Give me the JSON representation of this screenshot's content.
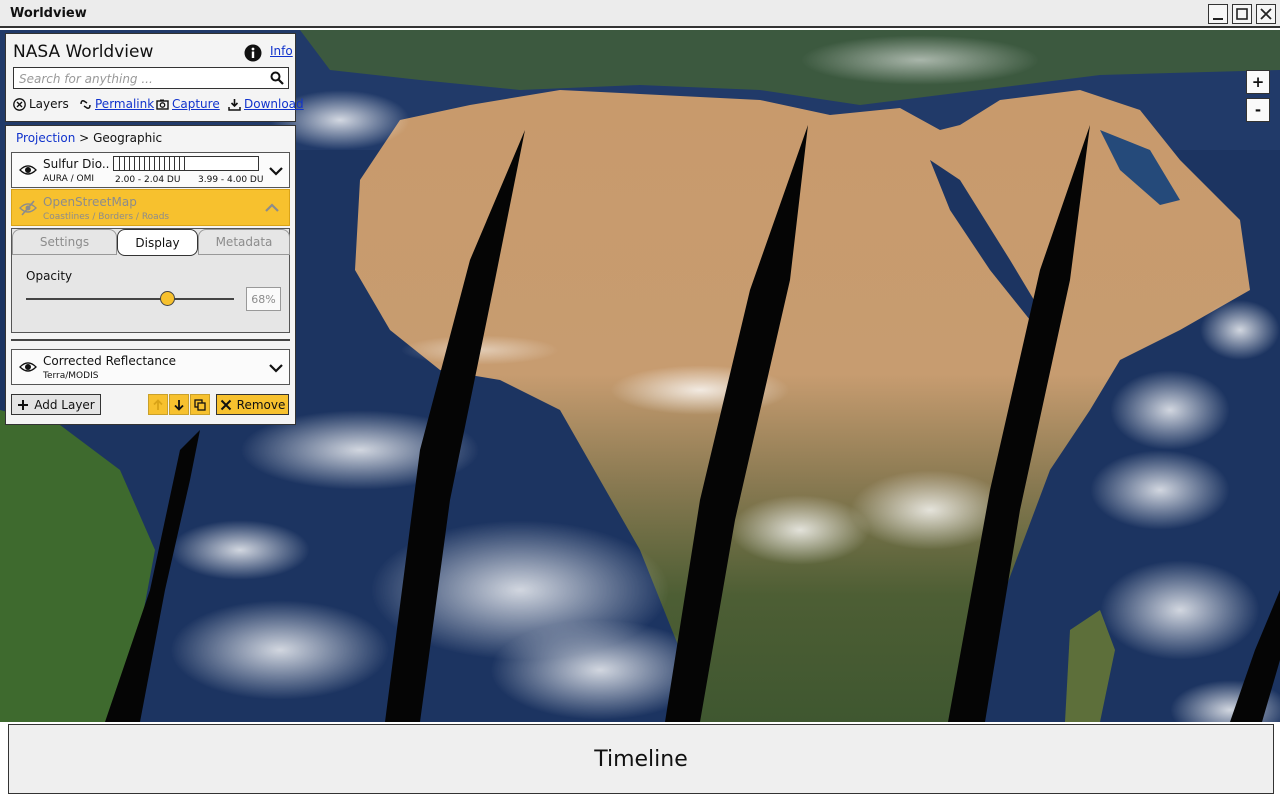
{
  "window": {
    "title": "Worldview"
  },
  "header": {
    "title": "NASA Worldview",
    "info_label": "Info",
    "search_placeholder": "Search for anything ...",
    "toolbar": {
      "layers": "Layers",
      "permalink": "Permalink",
      "capture": "Capture",
      "download": "Download"
    }
  },
  "breadcrumb": {
    "projection_label": "Projection",
    "separator": ">",
    "current": "Geographic"
  },
  "layers": [
    {
      "name": "Sulfur Dio..",
      "source": "AURA / OMI",
      "range_low": "2.00 - 2.04 DU",
      "range_high": "3.99 - 4.00 DU",
      "visible": true
    },
    {
      "name": "OpenStreetMap",
      "source": "Coastlines / Borders / Roads",
      "visible": false,
      "selected": true
    },
    {
      "name": "Corrected Reflectance",
      "source": "Terra/MODIS",
      "visible": true
    }
  ],
  "layer_settings": {
    "tabs": [
      "Settings",
      "Display",
      "Metadata"
    ],
    "active_tab": "Display",
    "opacity_label": "Opacity",
    "opacity_value": "68%",
    "opacity_fraction": 0.68
  },
  "actions": {
    "add_layer": "Add Layer",
    "remove": "Remove"
  },
  "zoom": {
    "in": "+",
    "out": "-"
  },
  "timeline": {
    "label": "Timeline"
  },
  "colors": {
    "accent": "#f7c12e",
    "link": "#1133cc",
    "ocean": "#17305a"
  }
}
